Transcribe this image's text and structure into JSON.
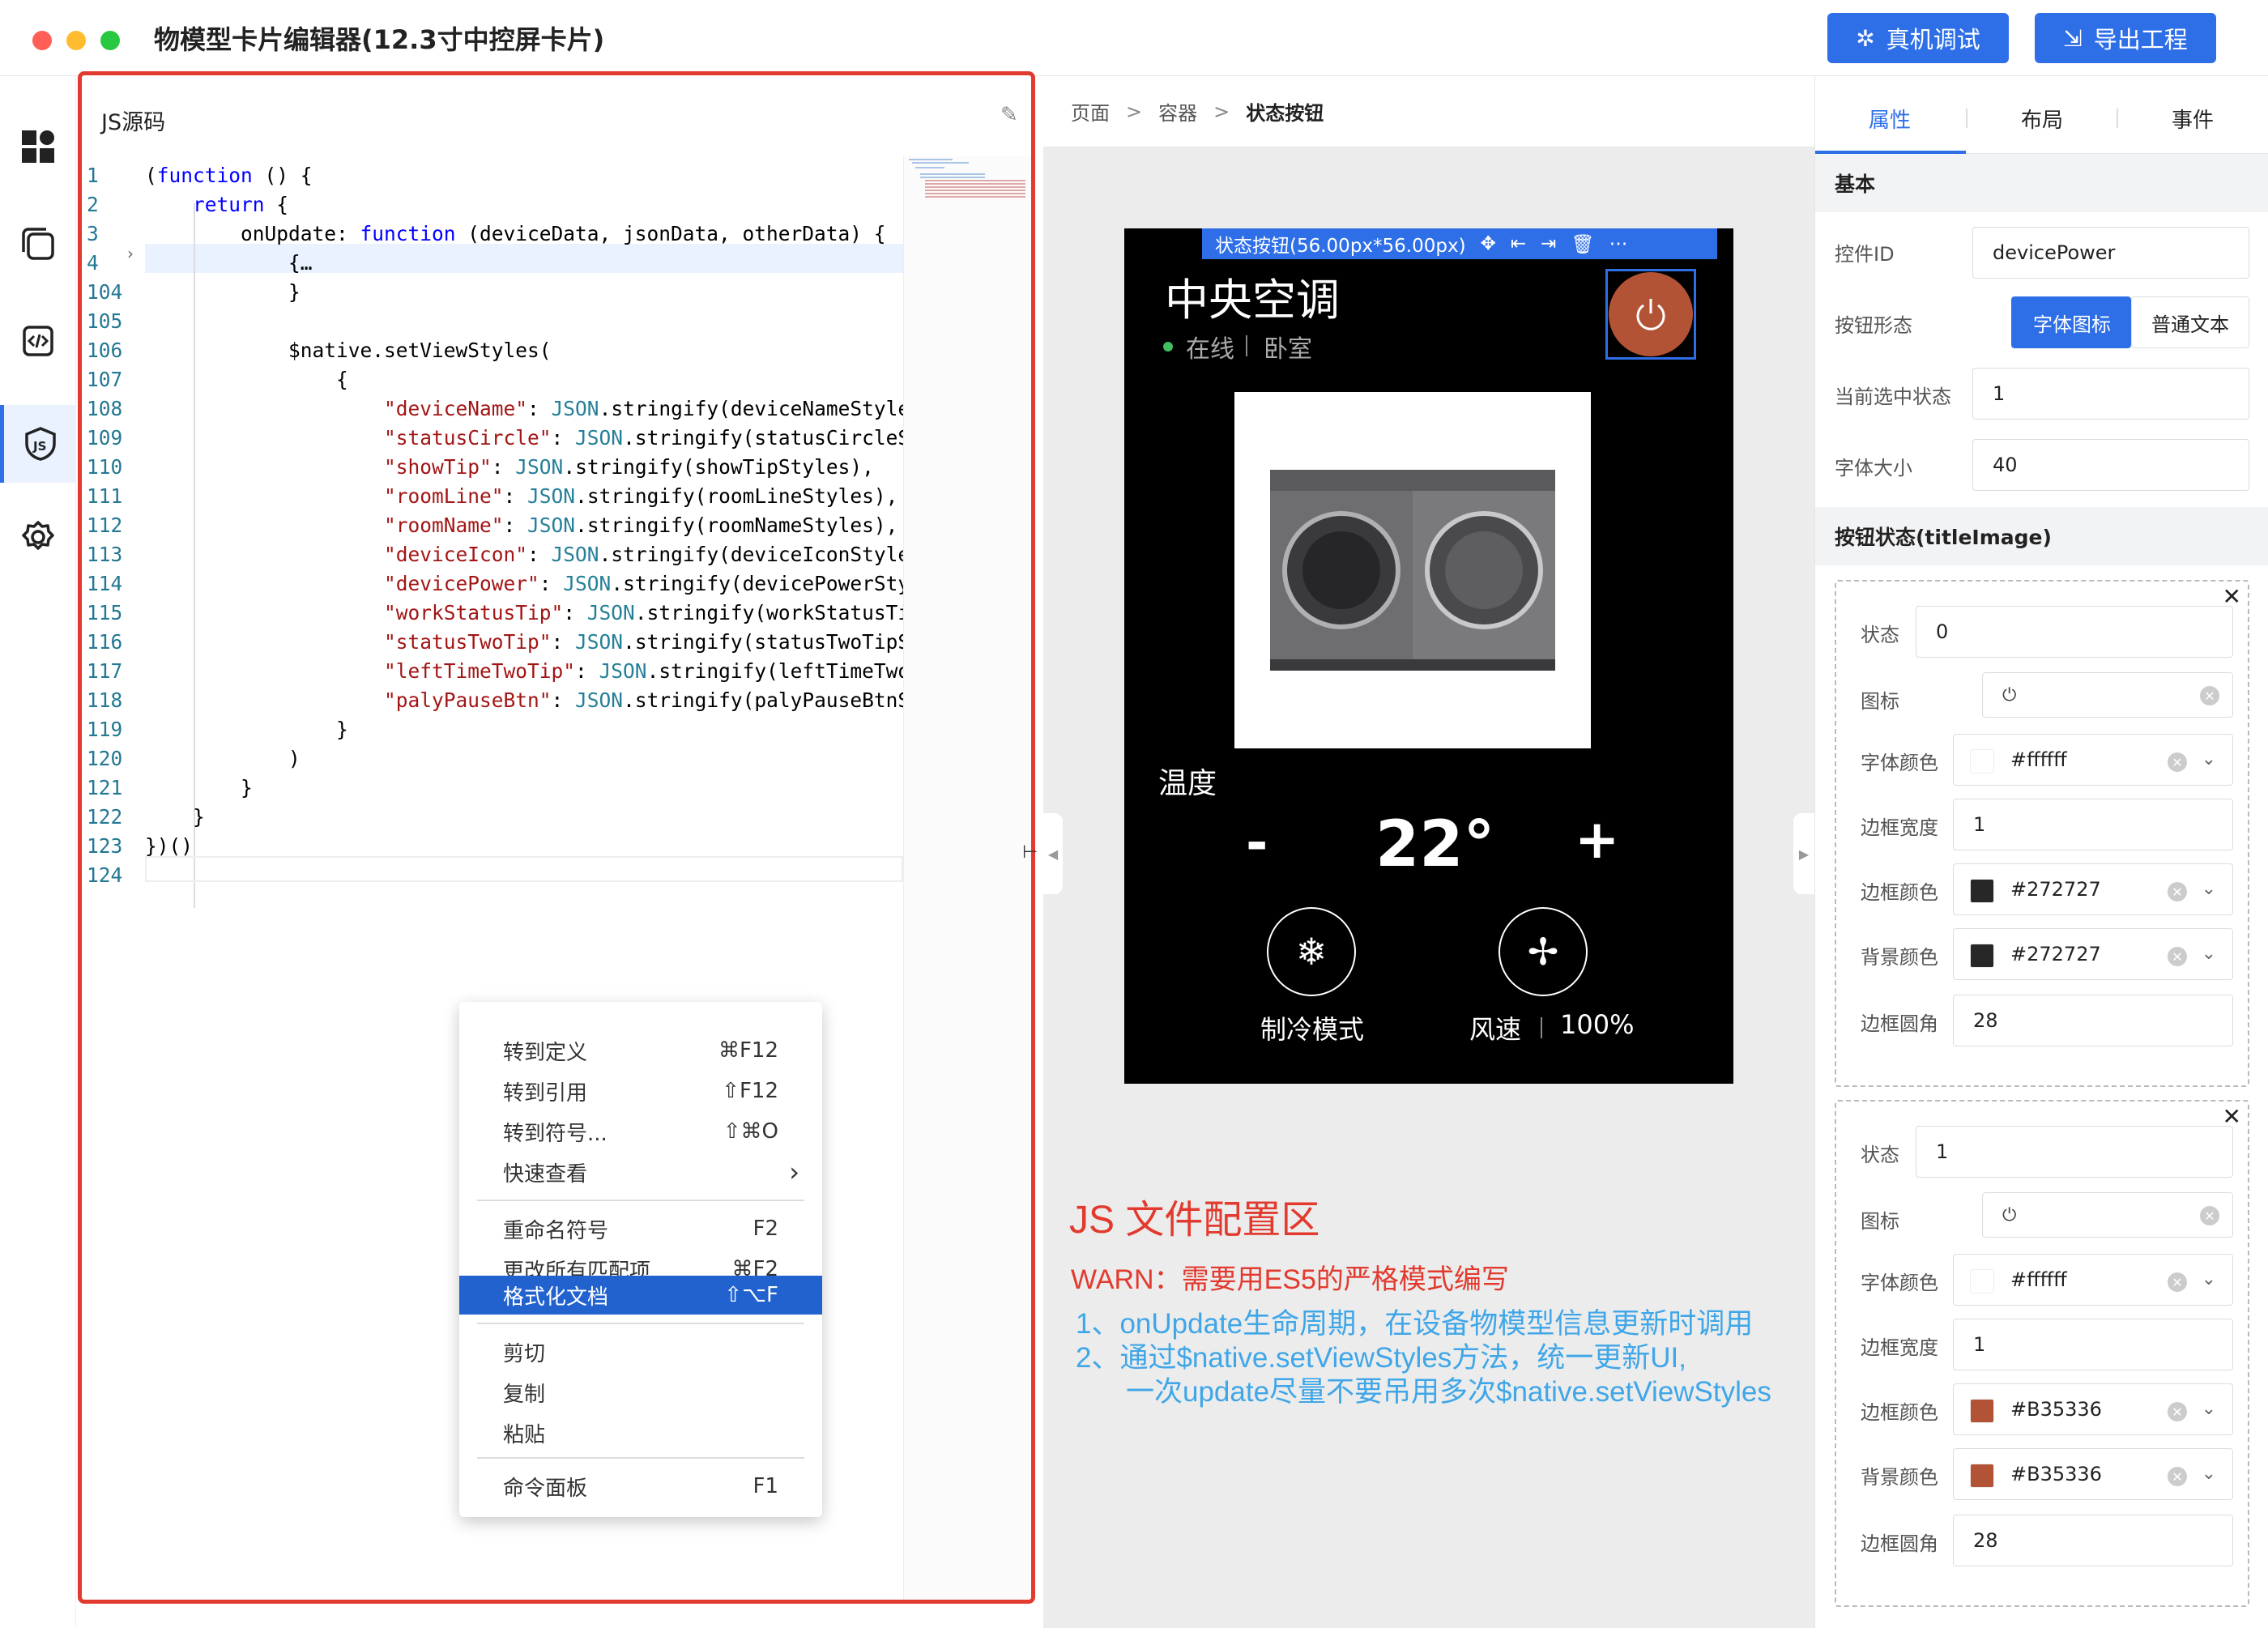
{
  "window": {
    "title": "物模型卡片编辑器(12.3寸中控屏卡片)",
    "buttons": {
      "debug": "真机调试",
      "export": "导出工程"
    },
    "colors": {
      "accent": "#2e6fe8",
      "highlight_border": "#e23a2e"
    }
  },
  "rail": {
    "items": [
      "components-icon",
      "layers-icon",
      "code-icon",
      "js-icon",
      "settings-icon"
    ],
    "active": "js-icon"
  },
  "editor": {
    "title": "JS源码",
    "lines": [
      {
        "n": "1",
        "code": "(function () {"
      },
      {
        "n": "2",
        "code": "    return {"
      },
      {
        "n": "3",
        "code": "        onUpdate: function (deviceData, jsonData, otherData) {"
      },
      {
        "n": "4",
        "code": "            {…"
      },
      {
        "n": "104",
        "code": "            }"
      },
      {
        "n": "105",
        "code": ""
      },
      {
        "n": "106",
        "code": "            $native.setViewStyles("
      },
      {
        "n": "107",
        "code": "                {"
      },
      {
        "n": "108",
        "code": "                    \"deviceName\": JSON.stringify(deviceNameStyles"
      },
      {
        "n": "109",
        "code": "                    \"statusCircle\": JSON.stringify(statusCircleSt"
      },
      {
        "n": "110",
        "code": "                    \"showTip\": JSON.stringify(showTipStyles),"
      },
      {
        "n": "111",
        "code": "                    \"roomLine\": JSON.stringify(roomLineStyles),"
      },
      {
        "n": "112",
        "code": "                    \"roomName\": JSON.stringify(roomNameStyles),"
      },
      {
        "n": "113",
        "code": "                    \"deviceIcon\": JSON.stringify(deviceIconStyles"
      },
      {
        "n": "114",
        "code": "                    \"devicePower\": JSON.stringify(devicePowerStyl"
      },
      {
        "n": "115",
        "code": "                    \"workStatusTip\": JSON.stringify(workStatusTip"
      },
      {
        "n": "116",
        "code": "                    \"statusTwoTip\": JSON.stringify(statusTwoTipSt"
      },
      {
        "n": "117",
        "code": "                    \"leftTimeTwoTip\": JSON.stringify(leftTimeTwoT"
      },
      {
        "n": "118",
        "code": "                    \"palyPauseBtn\": JSON.stringify(palyPauseBtnSt"
      },
      {
        "n": "119",
        "code": "                }"
      },
      {
        "n": "120",
        "code": "            )"
      },
      {
        "n": "121",
        "code": "        }"
      },
      {
        "n": "122",
        "code": "    }"
      },
      {
        "n": "123",
        "code": "})()"
      },
      {
        "n": "124",
        "code": ""
      }
    ],
    "context_menu": [
      {
        "label": "转到定义",
        "shortcut": "⌘F12"
      },
      {
        "label": "转到引用",
        "shortcut": "⇧F12"
      },
      {
        "label": "转到符号...",
        "shortcut": "⇧⌘O"
      },
      {
        "label": "快速查看",
        "shortcut": "›"
      },
      {
        "label": "重命名符号",
        "shortcut": "F2"
      },
      {
        "label": "更改所有匹配项",
        "shortcut": "⌘F2"
      },
      {
        "label": "格式化文档",
        "shortcut": "⇧⌥F"
      },
      {
        "label": "剪切",
        "shortcut": ""
      },
      {
        "label": "复制",
        "shortcut": ""
      },
      {
        "label": "粘贴",
        "shortcut": ""
      },
      {
        "label": "命令面板",
        "shortcut": "F1"
      }
    ],
    "selected_menu_item": "格式化文档"
  },
  "canvas": {
    "breadcrumb": [
      "页面",
      "容器",
      "状态按钮"
    ],
    "selection_label": "状态按钮(56.00px*56.00px)",
    "card": {
      "device_name": "中央空调",
      "status": "在线",
      "room": "卧室",
      "temp_label": "温度",
      "minus": "-",
      "temperature": "22°",
      "plus": "+",
      "mode_label": "制冷模式",
      "fan_label": "风速",
      "fan_value": "100%"
    },
    "note": {
      "title": "JS 文件配置区",
      "warn": "WARN：需要用ES5的严格模式编写",
      "line1": "1、onUpdate生命周期，在设备物模型信息更新时调用",
      "line2": "2、通过$native.setViewStyles方法，统一更新UI,",
      "line3": "一次update尽量不要吊用多次$native.setViewStyles"
    }
  },
  "props": {
    "tabs": [
      "属性",
      "布局",
      "事件"
    ],
    "active_tab": "属性",
    "basic_section": "基本",
    "fields": {
      "id_label": "控件ID",
      "id_value": "devicePower",
      "shape_label": "按钮形态",
      "shape_opt1": "字体图标",
      "shape_opt2": "普通文本",
      "state_label": "当前选中状态",
      "state_value": "1",
      "font_label": "字体大小",
      "font_value": "40"
    },
    "states_section": "按钮状态(titleImage)",
    "labels": {
      "state": "状态",
      "icon": "图标",
      "font_color": "字体颜色",
      "border_width": "边框宽度",
      "border_color": "边框颜色",
      "bg_color": "背景颜色",
      "radius": "边框圆角"
    },
    "states": [
      {
        "state": "0",
        "font_color": "#ffffff",
        "border_width": "1",
        "border_color": "#272727",
        "bg_color": "#272727",
        "radius": "28"
      },
      {
        "state": "1",
        "font_color": "#ffffff",
        "border_width": "1",
        "border_color": "#B35336",
        "bg_color": "#B35336",
        "radius": "28"
      }
    ]
  }
}
